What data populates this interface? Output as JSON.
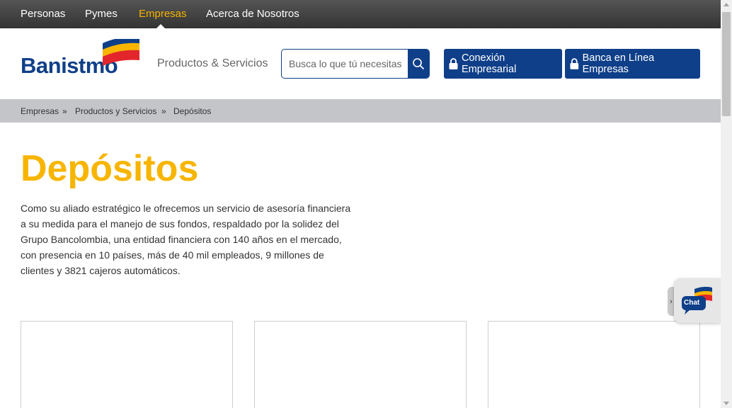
{
  "topnav": {
    "items": [
      {
        "label": "Personas",
        "active": false
      },
      {
        "label": "Pymes",
        "active": false
      },
      {
        "label": "Empresas",
        "active": true
      },
      {
        "label": "Acerca de Nosotros",
        "active": false
      }
    ]
  },
  "header": {
    "logo_text": "Banistmo",
    "products_link": "Productos & Servicios",
    "search": {
      "placeholder": "Busca lo que tú necesitas",
      "value": ""
    },
    "buttons": {
      "conexion": "Conexión Empresarial",
      "banca": "Banca en Línea Empresas"
    }
  },
  "breadcrumb": {
    "items": [
      "Empresas",
      "Productos y Servicios",
      "Depósitos"
    ],
    "separator": "»"
  },
  "main": {
    "title": "Depósitos",
    "intro": "Como su aliado estratégico le ofrecemos un servicio de asesoría financiera a su medida para el manejo de sus fondos, respaldado por la solidez del Grupo Bancolombia, una entidad financiera con 140 años en el mercado, con presencia en 10 países, más de 40 mil empleados, 9 millones de clientes y 3821 cajeros automáticos."
  },
  "chat": {
    "label": "Chat",
    "tab_arrow": "›"
  },
  "colors": {
    "brand_blue": "#0f3f88",
    "brand_yellow": "#f7b500",
    "brand_red": "#e3262c",
    "breadcrumb_bg": "#c4c5c9"
  },
  "icons": [
    "search-icon",
    "lock-icon",
    "chat-icon",
    "banistmo-flag-logo"
  ]
}
